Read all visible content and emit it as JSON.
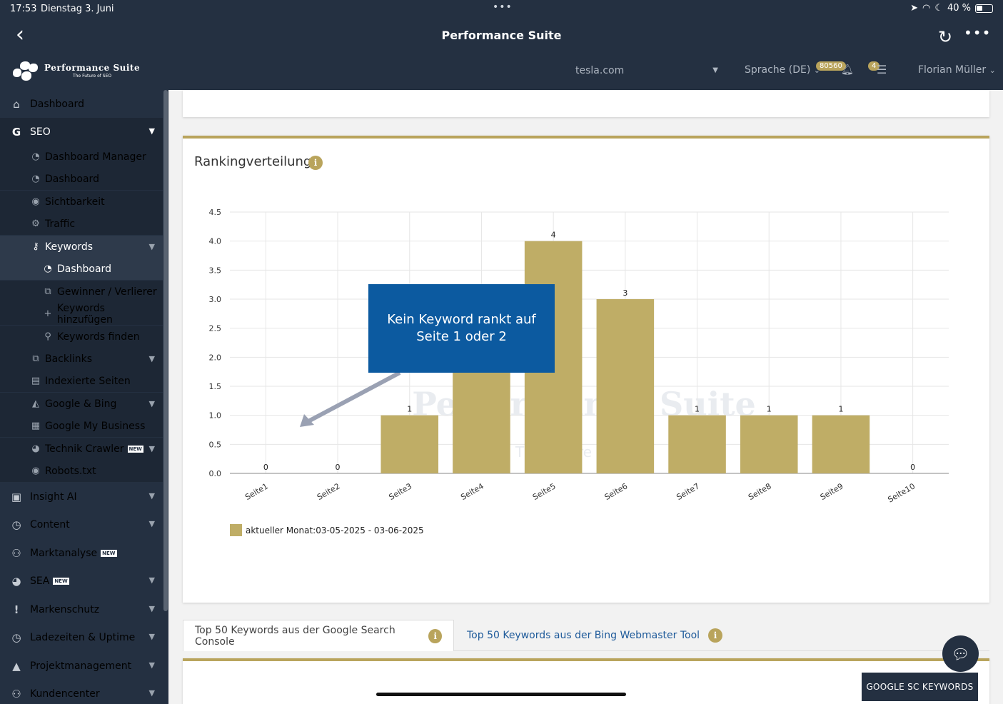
{
  "status": {
    "time": "17:53",
    "date": "Dienstag 3. Juni",
    "battery": "40 %"
  },
  "header": {
    "title": "Performance Suite",
    "more": "•••"
  },
  "logo": {
    "name": "Performance Suite",
    "tagline": "The Future of SEO"
  },
  "toolbar": {
    "domain": "tesla.com",
    "language": "Sprache (DE)",
    "notifications_badge": "80560",
    "tasks_badge": "4",
    "user": "Florian Müller"
  },
  "sidebar": {
    "dashboard": "Dashboard",
    "seo": "SEO",
    "seo_items": [
      "Dashboard Manager",
      "Dashboard",
      "Sichtbarkeit",
      "Traffic",
      "Keywords"
    ],
    "keyword_items": [
      "Dashboard",
      "Gewinner / Verlierer",
      "Keywords hinzufügen",
      "Keywords finden"
    ],
    "seo_items_2": [
      "Backlinks",
      "Indexierte Seiten",
      "Google & Bing",
      "Google My Business",
      "Technik Crawler",
      "Robots.txt"
    ],
    "main_items": [
      "Insight AI",
      "Content",
      "Marktanalyse",
      "SEA",
      "Markenschutz",
      "Ladezeiten & Uptime",
      "Projektmanagement",
      "Kundencenter"
    ],
    "new_label": "NEW"
  },
  "card": {
    "title": "Rankingverteilung",
    "info": "i",
    "callout": "Kein Keyword rankt auf Seite 1 oder 2"
  },
  "chart_data": {
    "type": "bar",
    "title": "Rankingverteilung",
    "categories": [
      "Seite1",
      "Seite2",
      "Seite3",
      "Seite4",
      "Seite5",
      "Seite6",
      "Seite7",
      "Seite8",
      "Seite9",
      "Seite10"
    ],
    "series": [
      {
        "name": "aktueller Monat:03-05-2025 - 03-06-2025",
        "values": [
          0,
          0,
          1,
          2,
          4,
          3,
          1,
          1,
          1,
          0
        ]
      }
    ],
    "data_labels": [
      "0",
      "0",
      "1",
      "",
      "4",
      "3",
      "1",
      "1",
      "1",
      "0"
    ],
    "y_ticks": [
      "0.0",
      "0.5",
      "1.0",
      "1.5",
      "2.0",
      "2.5",
      "3.0",
      "3.5",
      "4.0",
      "4.5"
    ],
    "ylim": [
      0,
      4.5
    ],
    "grid": true,
    "legend": "bottom-left",
    "bar_color": "#bfad66",
    "watermark": {
      "name": "Performance Suite",
      "tagline": "The Future of SEO"
    }
  },
  "tabs": {
    "google": "Top 50 Keywords aus der Google Search Console",
    "bing": "Top 50 Keywords aus der Bing Webmaster Tool"
  },
  "buttons": {
    "gsc": "GOOGLE SC KEYWORDS"
  },
  "colors": {
    "nav_bg": "#243041",
    "accent": "#b9a45c",
    "callout": "#0c5aa0"
  }
}
